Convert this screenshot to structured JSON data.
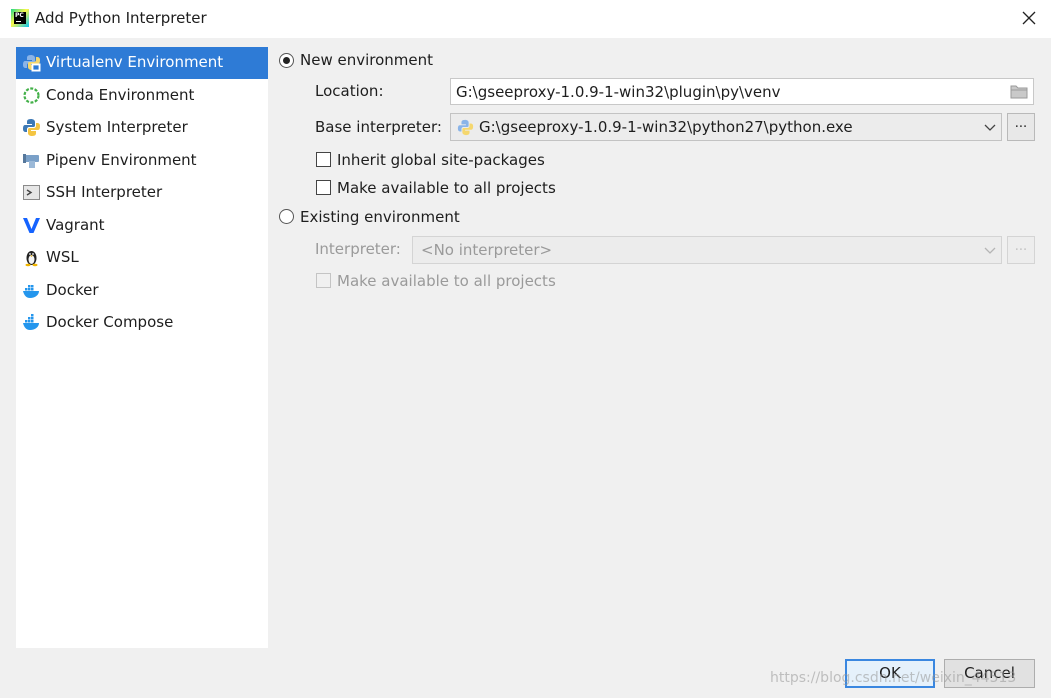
{
  "window": {
    "title": "Add Python Interpreter",
    "close_glyph": "✕"
  },
  "sidebar": {
    "items": [
      {
        "label": "Virtualenv Environment",
        "icon": "virtualenv-icon",
        "selected": true
      },
      {
        "label": "Conda Environment",
        "icon": "conda-icon"
      },
      {
        "label": "System Interpreter",
        "icon": "python-icon"
      },
      {
        "label": "Pipenv Environment",
        "icon": "pipenv-icon"
      },
      {
        "label": "SSH Interpreter",
        "icon": "ssh-terminal-icon"
      },
      {
        "label": "Vagrant",
        "icon": "vagrant-icon"
      },
      {
        "label": "WSL",
        "icon": "linux-penguin-icon"
      },
      {
        "label": "Docker",
        "icon": "docker-icon"
      },
      {
        "label": "Docker Compose",
        "icon": "docker-compose-icon"
      }
    ]
  },
  "new_env": {
    "radio_label": "New environment",
    "selected": true,
    "location_label": "Location:",
    "location_value": "G:\\gseeproxy-1.0.9-1-win32\\plugin\\py\\venv",
    "base_label": "Base interpreter:",
    "base_value": "G:\\gseeproxy-1.0.9-1-win32\\python27\\python.exe",
    "inherit_label": "Inherit global site-packages",
    "make_available_label": "Make available to all projects",
    "ellipsis": "..."
  },
  "existing_env": {
    "radio_label": "Existing environment",
    "interpreter_label": "Interpreter:",
    "interpreter_value": "<No interpreter>",
    "make_available_label": "Make available to all projects",
    "ellipsis": "..."
  },
  "footer": {
    "ok_label": "OK",
    "cancel_label": "Cancel",
    "watermark": "https://blog.csdn.net/weixin_44513"
  },
  "colors": {
    "selection": "#2e7bd6",
    "ok_border": "#3a87e0"
  }
}
